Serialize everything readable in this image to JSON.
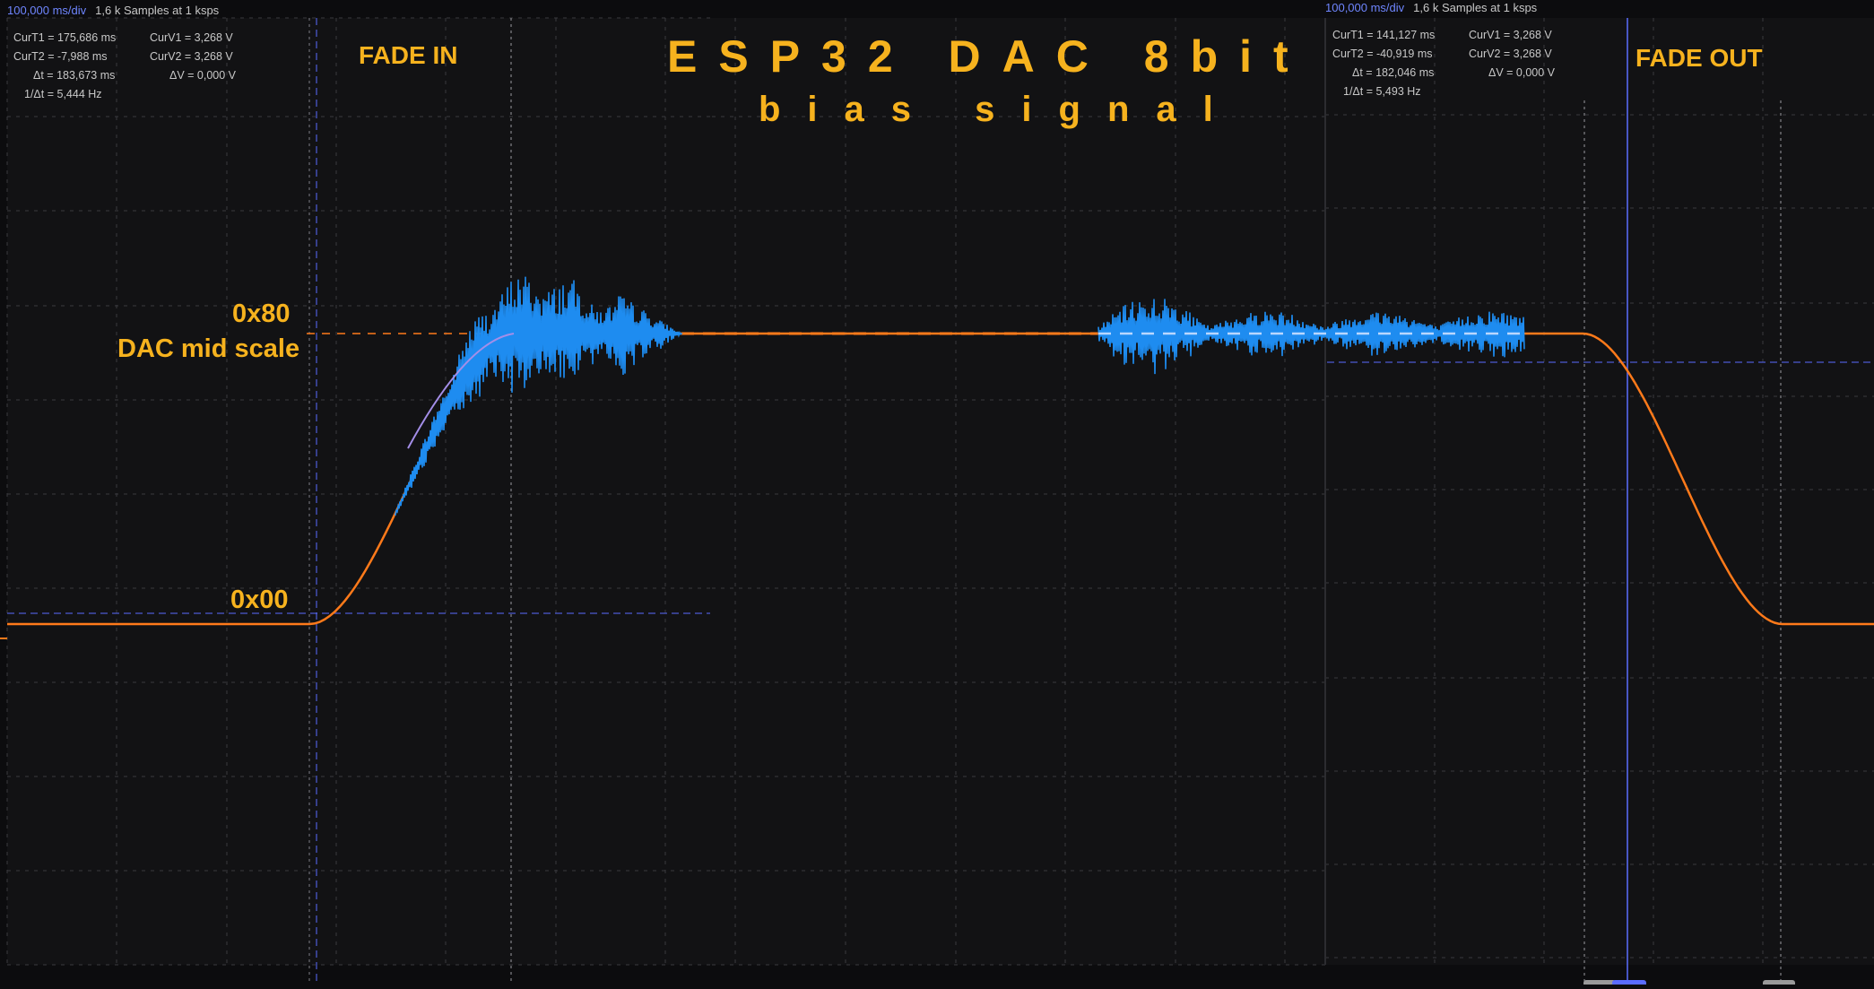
{
  "left_panel": {
    "timebase": "100,000 ms/div",
    "samples": "1,6 k Samples at 1 ksps",
    "cursors": {
      "curT1": "CurT1 =  175,686 ms",
      "curV1": "CurV1 =  3,268 V",
      "curT2": "CurT2 =  -7,988 ms",
      "curV2": "CurV2 =  3,268 V",
      "dt": "Δt =  183,673 ms",
      "dv": "ΔV =  0,000 V",
      "freq": "1/Δt =  5,444 Hz"
    }
  },
  "right_panel": {
    "timebase": "100,000 ms/div",
    "samples": "1,6 k Samples at 1 ksps",
    "cursors": {
      "curT1": "CurT1 =  141,127 ms",
      "curV1": "CurV1 =  3,268 V",
      "curT2": "CurT2 =  -40,919 ms",
      "curV2": "CurV2 =  3,268 V",
      "dt": "Δt =  182,046 ms",
      "dv": "ΔV =  0,000 V",
      "freq": "1/Δt =  5,493 Hz"
    }
  },
  "annotations": {
    "title": "ESP32 DAC 8bit",
    "subtitle": "bias signal",
    "fade_in": "FADE IN",
    "fade_out": "FADE OUT",
    "level_high": "0x80",
    "level_high_desc": "DAC mid scale",
    "level_low": "0x00"
  },
  "colors": {
    "background": "#121214",
    "grid": "#3a3a3e",
    "label": "#f6b21e",
    "trace_dac": "#ff7a1a",
    "trace_audio": "#1e8cf0",
    "cursor": "#5a6cff",
    "header_timebase": "#6f86ff"
  }
}
